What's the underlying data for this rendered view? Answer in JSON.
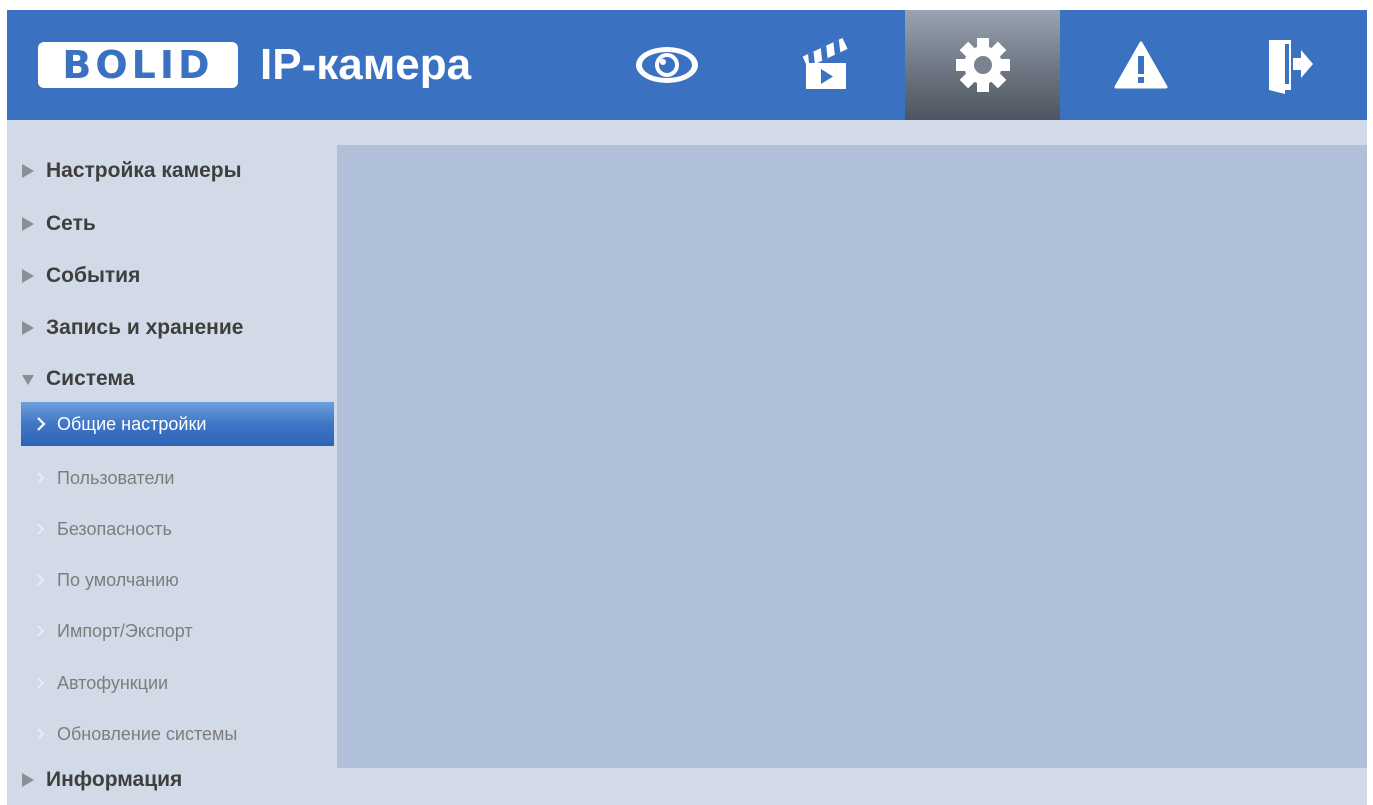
{
  "header": {
    "logo_text": "BOLID",
    "product_name": "IP-камера",
    "nav": [
      {
        "icon": "eye-icon",
        "name": "live-view"
      },
      {
        "icon": "clapperboard-icon",
        "name": "playback"
      },
      {
        "icon": "gear-icon",
        "name": "settings",
        "active": true
      },
      {
        "icon": "warning-icon",
        "name": "alarm"
      },
      {
        "icon": "logout-icon",
        "name": "logout"
      }
    ]
  },
  "sidebar": {
    "sections": [
      {
        "label": "Настройка камеры",
        "expanded": false
      },
      {
        "label": "Сеть",
        "expanded": false
      },
      {
        "label": "События",
        "expanded": false
      },
      {
        "label": "Запись и хранение",
        "expanded": false
      },
      {
        "label": "Система",
        "expanded": true
      },
      {
        "label": "Информация",
        "expanded": false
      }
    ],
    "system_items": [
      {
        "label": "Общие настройки",
        "selected": true
      },
      {
        "label": "Пользователи",
        "selected": false
      },
      {
        "label": "Безопасность",
        "selected": false
      },
      {
        "label": "По умолчанию",
        "selected": false
      },
      {
        "label": "Импорт/Экспорт",
        "selected": false
      },
      {
        "label": "Автофункции",
        "selected": false
      },
      {
        "label": "Обновление системы",
        "selected": false
      }
    ]
  },
  "colors": {
    "header_bg": "#3a72c1",
    "sidebar_bg": "#d1dae6",
    "content_bg": "#afc0d8",
    "selected_item": "#3f76c6"
  }
}
